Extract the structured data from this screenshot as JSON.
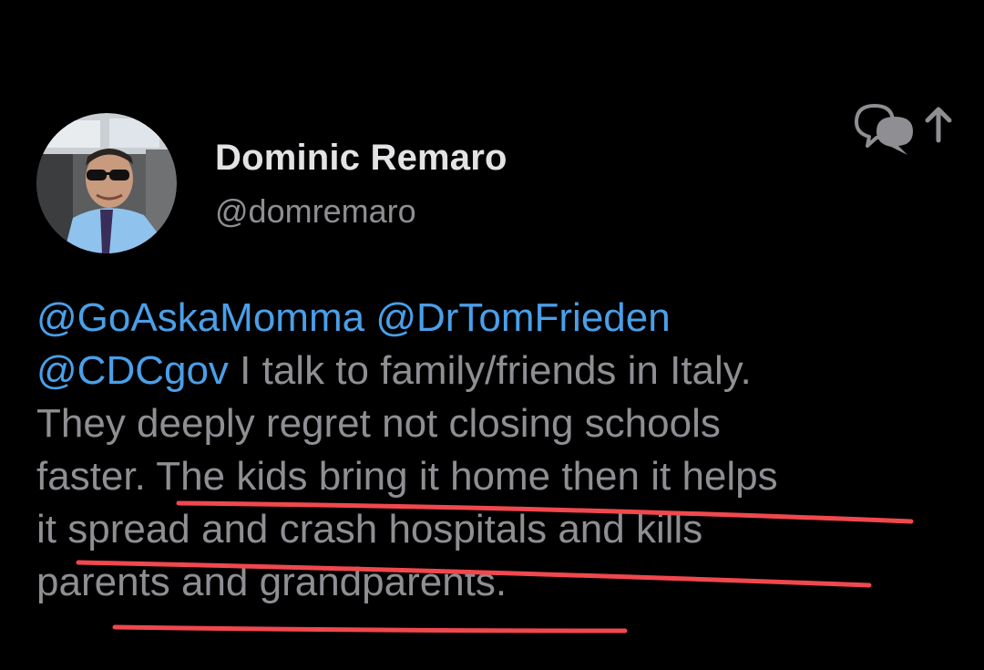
{
  "tweet": {
    "author": {
      "display_name": "Dominic Remaro",
      "handle": "@domremaro"
    },
    "mentions": [
      "@GoAskaMomma",
      "@DrTomFrieden",
      "@CDCgov"
    ],
    "text_lines": [
      " I talk to family/friends in Italy.",
      "They deeply regret not closing schools",
      "faster. The kids bring it home then it helps",
      "it spread and crash hospitals and kills",
      "parents and grandparents."
    ]
  },
  "icons": {
    "share": "conversation-share-icon"
  },
  "colors": {
    "background": "#000000",
    "mention": "#4a9fe8",
    "body_text": "#8e8e93",
    "display_name": "#e3e3e6",
    "annotation_underline": "#f0484e"
  }
}
